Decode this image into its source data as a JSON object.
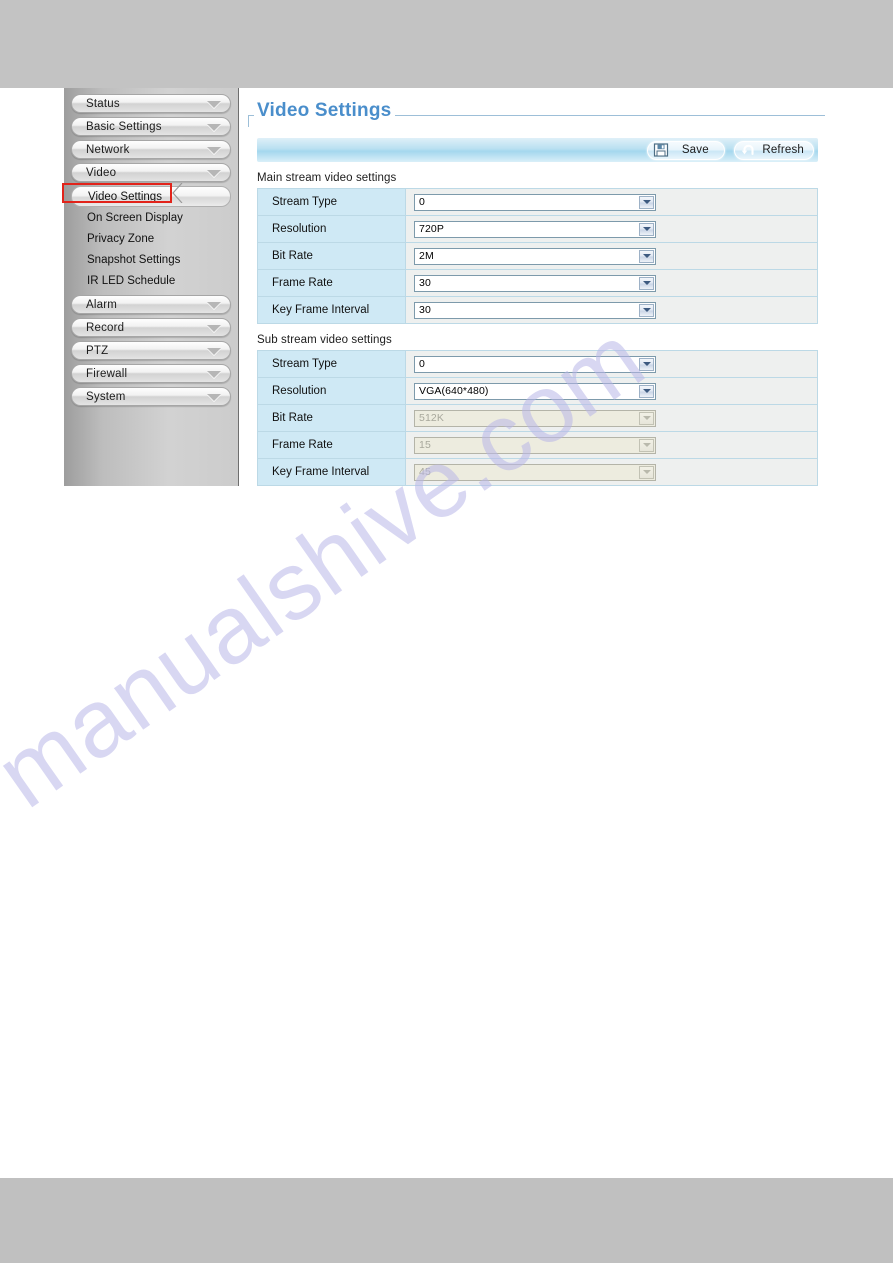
{
  "page": {
    "watermark": "manualshive.com"
  },
  "sidebar": {
    "menu": [
      {
        "label": "Status",
        "expanded": false
      },
      {
        "label": "Basic Settings",
        "expanded": false
      },
      {
        "label": "Network",
        "expanded": false
      },
      {
        "label": "Video",
        "expanded": true
      },
      {
        "label": "Alarm",
        "expanded": false
      },
      {
        "label": "Record",
        "expanded": false
      },
      {
        "label": "PTZ",
        "expanded": false
      },
      {
        "label": "Firewall",
        "expanded": false
      },
      {
        "label": "System",
        "expanded": false
      }
    ],
    "video_submenu": [
      {
        "label": "Video Settings",
        "selected": true
      },
      {
        "label": "On Screen Display",
        "selected": false
      },
      {
        "label": "Privacy Zone",
        "selected": false
      },
      {
        "label": "Snapshot Settings",
        "selected": false
      },
      {
        "label": "IR LED Schedule",
        "selected": false
      }
    ],
    "highlight_color": "#e2231a"
  },
  "main": {
    "title": "Video Settings",
    "title_color": "#4a8ecb",
    "toolbar": {
      "save_label": "Save",
      "refresh_label": "Refresh"
    },
    "main_stream": {
      "section_label": "Main stream video settings",
      "rows": [
        {
          "label": "Stream Type",
          "value": "0",
          "disabled": false
        },
        {
          "label": "Resolution",
          "value": "720P",
          "disabled": false
        },
        {
          "label": "Bit Rate",
          "value": "2M",
          "disabled": false
        },
        {
          "label": "Frame Rate",
          "value": "30",
          "disabled": false
        },
        {
          "label": "Key Frame Interval",
          "value": "30",
          "disabled": false
        }
      ]
    },
    "sub_stream": {
      "section_label": "Sub stream video settings",
      "rows": [
        {
          "label": "Stream Type",
          "value": "0",
          "disabled": false
        },
        {
          "label": "Resolution",
          "value": "VGA(640*480)",
          "disabled": false
        },
        {
          "label": "Bit Rate",
          "value": "512K",
          "disabled": true
        },
        {
          "label": "Frame Rate",
          "value": "15",
          "disabled": true
        },
        {
          "label": "Key Frame Interval",
          "value": "45",
          "disabled": true
        }
      ]
    }
  }
}
